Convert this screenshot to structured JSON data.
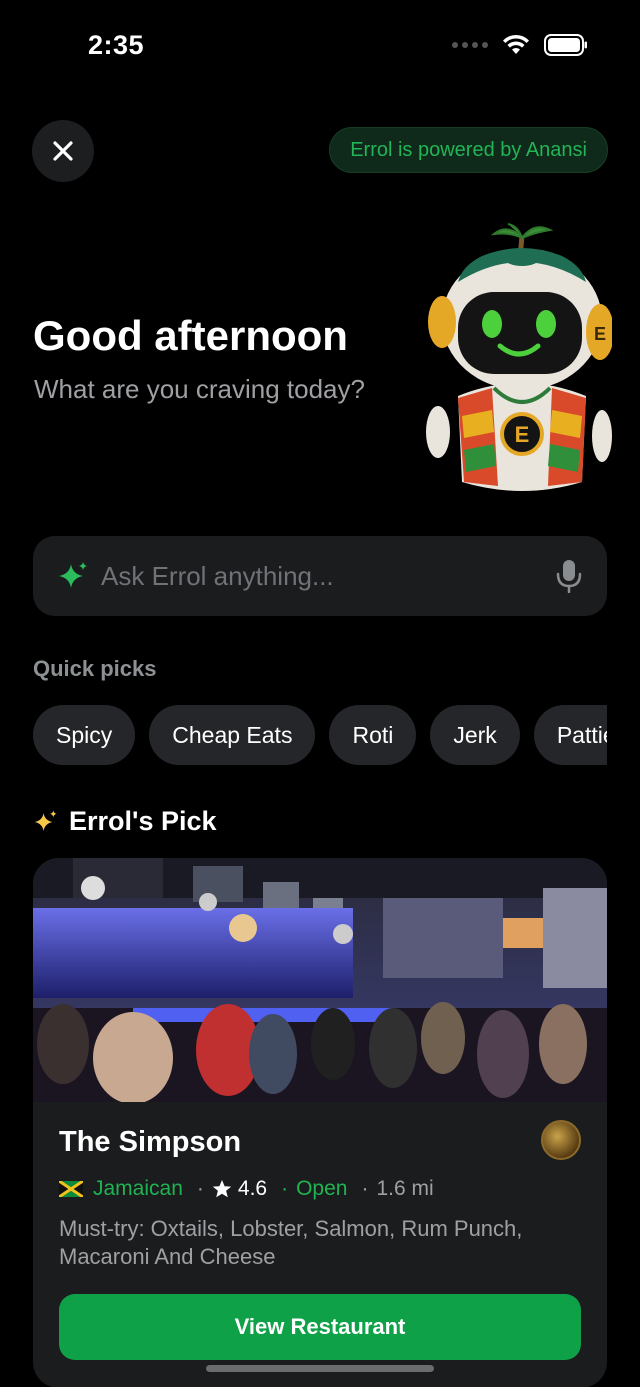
{
  "status": {
    "time": "2:35"
  },
  "header": {
    "powered_by": "Errol is powered by Anansi"
  },
  "greeting": {
    "title": "Good afternoon",
    "subtitle": "What are you craving today?"
  },
  "search": {
    "placeholder": "Ask Errol anything..."
  },
  "quick_picks": {
    "label": "Quick picks",
    "chips": [
      "Spicy",
      "Cheap Eats",
      "Roti",
      "Jerk",
      "Patties"
    ]
  },
  "errols_pick": {
    "heading": "Errol's Pick",
    "restaurant": {
      "name": "The Simpson",
      "cuisine": "Jamaican",
      "rating": "4.6",
      "status": "Open",
      "distance": "1.6 mi",
      "must_try": "Must-try: Oxtails, Lobster, Salmon, Rum Punch, Macaroni And Cheese",
      "button_label": "View Restaurant"
    }
  },
  "colors": {
    "accent_green": "#0ea147",
    "background": "#000000",
    "surface": "#1a1c1e"
  },
  "icons": [
    "close-icon",
    "wifi-icon",
    "battery-icon",
    "sparkle-icon",
    "mic-icon",
    "star-icon",
    "jamaica-flag-icon"
  ]
}
